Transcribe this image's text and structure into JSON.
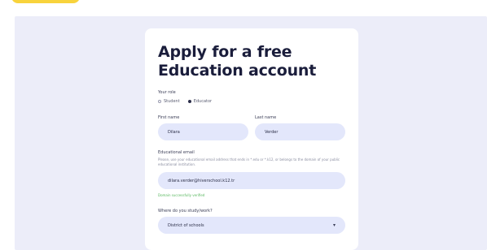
{
  "form": {
    "title_line1": "Apply for a free",
    "title_line2": "Education account",
    "role_label": "Your role",
    "role_options": [
      "Student",
      "Educator"
    ],
    "role_selected": "Educator",
    "first_name_label": "First name",
    "first_name_value": "Dilara",
    "last_name_label": "Last name",
    "last_name_value": "Verder",
    "email_label": "Educational email",
    "email_help": "Please, use your educational email address that ends in *.edu or *.k12, or belongs to the domain of your public educational institution.",
    "email_value": "dilara.verder@hiverschool.k12.tr",
    "email_status": "Domain successfully verified",
    "study_label": "Where do you study/work?",
    "study_value": "District of schools"
  },
  "colors": {
    "brand_yellow": "#f8d33c",
    "background": "#ecedf9",
    "field_fill": "#e3e7fb",
    "success": "#59b85f",
    "title_text": "#1a1d3b"
  },
  "icons": {
    "select_chevron": "chevron-down-icon"
  }
}
